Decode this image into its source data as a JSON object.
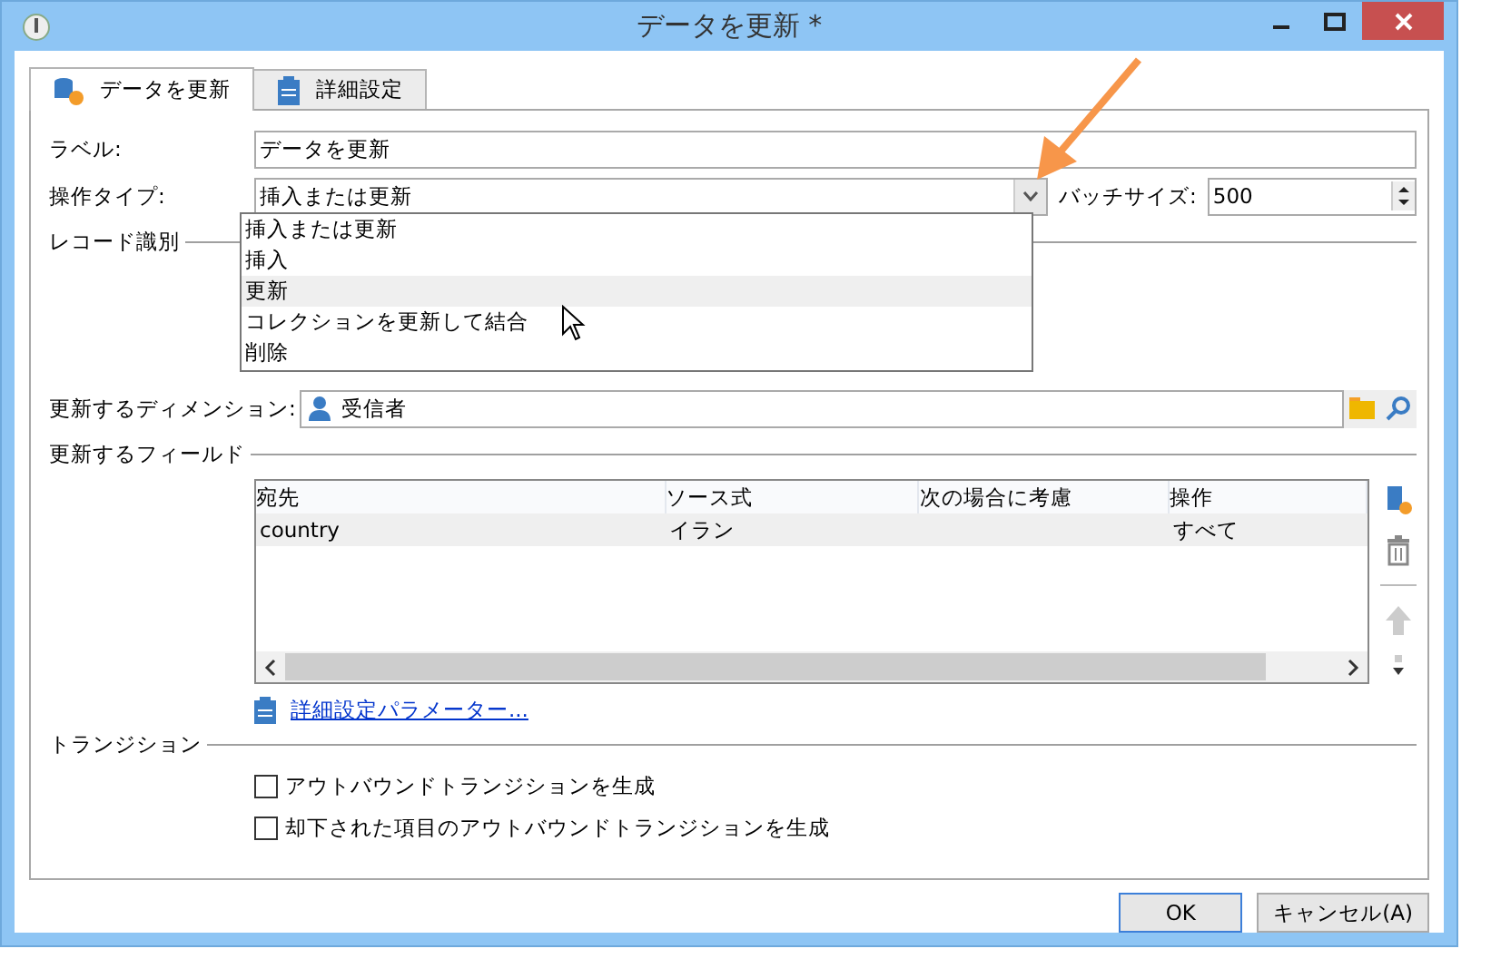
{
  "window": {
    "title": "データを更新 *"
  },
  "tabs": [
    {
      "label": "データを更新",
      "selected": true
    },
    {
      "label": "詳細設定",
      "selected": false
    }
  ],
  "label_field": {
    "label": "ラベル:",
    "value": "データを更新"
  },
  "operation_type": {
    "label": "操作タイプ:",
    "value": "挿入または更新",
    "expanded": true,
    "options": [
      {
        "label": "挿入または更新",
        "highlighted": false
      },
      {
        "label": "挿入",
        "highlighted": false
      },
      {
        "label": "更新",
        "highlighted": true
      },
      {
        "label": "コレクションを更新して結合",
        "highlighted": false
      },
      {
        "label": "削除",
        "highlighted": false
      }
    ]
  },
  "batch_size": {
    "label": "バッチサイズ:",
    "value": "500"
  },
  "record_section": {
    "title": "レコード識別"
  },
  "dimension": {
    "label": "更新するディメンション:",
    "value": "受信者"
  },
  "fields_section": {
    "title": "更新するフィールド"
  },
  "table": {
    "columns": [
      "宛先",
      "ソース式",
      "次の場合に考慮",
      "操作"
    ],
    "rows": [
      {
        "cells": [
          "country",
          "イラン",
          "",
          "すべて"
        ],
        "selected": true
      }
    ]
  },
  "advanced_link": "詳細設定パラメーター...",
  "transition_section": {
    "title": "トランジション"
  },
  "checkboxes": [
    {
      "label": "アウトバウンドトランジションを生成",
      "checked": false
    },
    {
      "label": "却下された項目のアウトバウンドトランジションを生成",
      "checked": false
    }
  ],
  "buttons": [
    {
      "label": "OK",
      "default": true
    },
    {
      "label": "キャンセル(A)",
      "default": false
    }
  ]
}
